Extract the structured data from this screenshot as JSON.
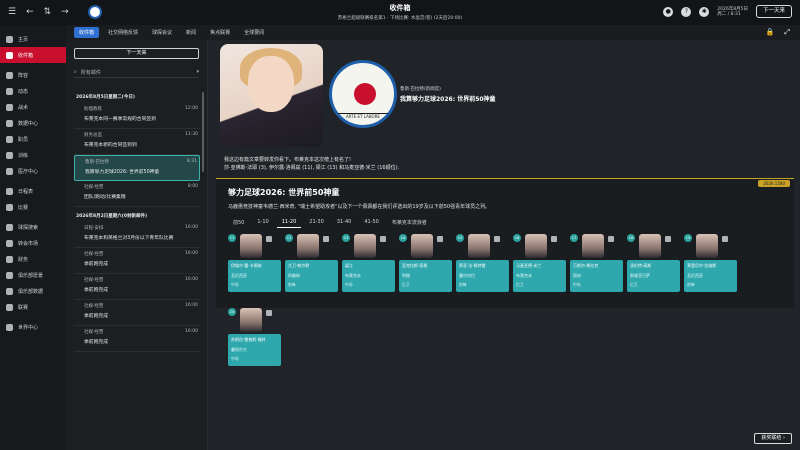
{
  "topbar": {
    "title": "收件箱",
    "subtitle_line1": "苏格兰超级联赛排名第1 · 下场比赛: 水晶宫(客)",
    "subtitle_line2": "(2天后20:00)",
    "date_line1": "2026年8月5日",
    "date_line2": "周二 / 8:31",
    "continue_label": "下一天来",
    "help_label": "?"
  },
  "leftnav": {
    "items": [
      {
        "label": "主页"
      },
      {
        "label": "收件箱",
        "active": true
      },
      {
        "label": "阵容"
      },
      {
        "label": "动态"
      },
      {
        "label": "战术"
      },
      {
        "label": "数据中心"
      },
      {
        "label": "职员"
      },
      {
        "label": "训练"
      },
      {
        "label": "医疗中心"
      },
      {
        "label": "日程表"
      },
      {
        "label": "比赛"
      },
      {
        "label": "球探搜索"
      },
      {
        "label": "转会市场"
      },
      {
        "label": "财务"
      },
      {
        "label": "俱乐部愿景"
      },
      {
        "label": "俱乐部数据"
      },
      {
        "label": "联赛"
      },
      {
        "label": "世界中心"
      }
    ]
  },
  "tabs": [
    {
      "label": "收件箱",
      "active": true
    },
    {
      "label": "社交网络反馈"
    },
    {
      "label": "球探会议"
    },
    {
      "label": "新闻"
    },
    {
      "label": "焦点联赛"
    },
    {
      "label": "全球要闻"
    }
  ],
  "inbox": {
    "new_button": "下一天来",
    "filter_placeholder": "所有邮件",
    "date_header_1": "2026年8月5日星期二(今日)",
    "date_header_2": "2026年8月2日星期六(0封新邮件)",
    "messages": [
      {
        "from": "助理教练",
        "subject": "布莱克本同一赛季常规的合同签到",
        "time": "12:00"
      },
      {
        "from": "财务总监",
        "subject": "布莱克本新的合同签到到",
        "time": "11:30"
      },
      {
        "from": "鲁斯·巴拉特",
        "subject": "我算够力足球2026: 世界前50神童",
        "time": "8:31",
        "selected": true
      },
      {
        "from": "社媒·经营",
        "subject": "团队/跑动/比赛集锦",
        "time": "8:00"
      },
      {
        "from": "日程·安排",
        "subject": "布莱克本和英格兰对3月份以下青年队比赛",
        "time": "16:00"
      },
      {
        "from": "社媒·经营",
        "subject": "季前跑完成",
        "time": "16:00"
      },
      {
        "from": "社媒·经营",
        "subject": "季前跑完成",
        "time": "16:00"
      },
      {
        "from": "社媒·经营",
        "subject": "季前跑完成",
        "time": "16:00"
      },
      {
        "from": "社媒·经营",
        "subject": "季前跑完成",
        "time": "16:00"
      }
    ]
  },
  "message": {
    "from": "鲁斯·巴拉特(新闻官)",
    "subject": "我算够力足球2026: 世界前50神童",
    "crest_motto": "ARTE ET LABORE",
    "body_line1": "我这边有篇文章要转发你看下。布莱克本这次榜上有名了!",
    "body_line2": "莎·亚佛斯·法耶 (3), 伊尔露·洛佩兹 (11), 梁江 (13) 和马麦亚德·米兰 (16顺位).",
    "badge": "2026.1580"
  },
  "article": {
    "title": "够力足球2026: 世界前50神童",
    "body": "马鹿惠竞技神童韦德兰·西米奇, \"瑞士希望助攻者\"以及下一个佩佩都在我们评选出的19岁及以下前50强青年球员之列。",
    "rank_tabs": [
      {
        "label": "前50"
      },
      {
        "label": "1-10"
      },
      {
        "label": "11-20",
        "active": true
      },
      {
        "label": "21-30"
      },
      {
        "label": "31-40"
      },
      {
        "label": "41-50"
      },
      {
        "label": "布莱克本流浪者"
      }
    ],
    "cards": [
      {
        "rank": "11",
        "name": "伊维尔·蕾·卡德纳",
        "club": "瓦伦西亚",
        "pos": "中场"
      },
      {
        "rank": "12",
        "name": "大卫·帕尔默",
        "club": "阿森纳",
        "pos": "前锋"
      },
      {
        "rank": "13",
        "name": "梁江",
        "club": "布莱克本",
        "pos": "中场"
      },
      {
        "rank": "14",
        "name": "亚克拉斯·塔格",
        "club": "利物",
        "pos": "后卫"
      },
      {
        "rank": "15",
        "name": "蒂亚·法·佩特雷",
        "club": "曼尔内巴",
        "pos": "前锋"
      },
      {
        "rank": "16",
        "name": "马麦亚德·米兰",
        "club": "布莱克本",
        "pos": "后卫"
      },
      {
        "rank": "17",
        "name": "万斯尔·希拉克",
        "club": "国米",
        "pos": "中场"
      },
      {
        "rank": "18",
        "name": "凌伦特·高斯",
        "club": "那维亚巴萨",
        "pos": "后卫"
      },
      {
        "rank": "19",
        "name": "莱登尼尔·拉维斯",
        "club": "瓦伦西亚",
        "pos": "前锋"
      },
      {
        "rank": "20",
        "name": "苏斯伯·雷普斯·福特",
        "club": "曼彻尔大",
        "pos": "中场"
      }
    ]
  },
  "reply_button": "获奖联结"
}
